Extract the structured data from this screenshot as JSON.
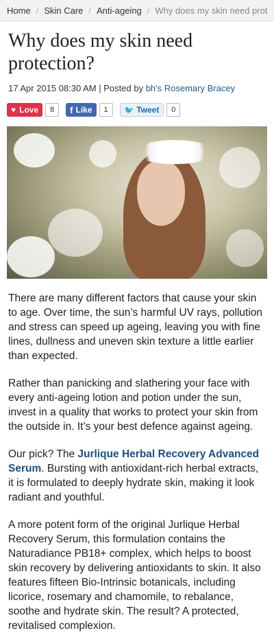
{
  "breadcrumb": {
    "home": "Home",
    "skin_care": "Skin Care",
    "anti_ageing": "Anti-ageing",
    "current": "Why does my skin need prot"
  },
  "article": {
    "title": "Why does my skin need protection?",
    "meta_prefix": "17 Apr 2015 08:30 AM | Posted by ",
    "author": "bh's Rosemary Bracey"
  },
  "share": {
    "love_label": "Love",
    "love_count": "8",
    "like_label": "Like",
    "like_count": "1",
    "tweet_label": "Tweet",
    "tweet_count": "0",
    "colors": {
      "love": "#e1304a",
      "facebook": "#4267b2",
      "twitter": "#1da1f2"
    }
  },
  "paragraphs": {
    "p1": "There are many different factors that cause your skin to age. Over time, the sun’s harmful UV rays, pollution and stress can speed up ageing, leaving you with fine lines, dullness and uneven skin texture a little earlier than expected.",
    "p2": "Rather than panicking and slathering your face with every anti-ageing lotion and potion under the sun, invest in a quality that works to protect your skin from the outside in. It’s your best defence against ageing.",
    "p3_prefix": "Our pick? The ",
    "p3_link": "Jurlique Herbal Recovery Advanced Serum",
    "p3_suffix": ". Bursting with antioxidant-rich herbal extracts, it is formulated to deeply hydrate skin, making it look radiant and youthful.",
    "p4": "A more potent form of the original Jurlique Herbal Recovery Serum, this formulation contains the Naturadiance PB18+ complex, which helps to boost skin recovery by delivering antioxidants to skin. It also features fifteen Bio-Intrinsic botanicals, including licorice, rosemary and chamomile, to rebalance, soothe and hydrate skin. The result? A protected, revitalised complexion."
  }
}
